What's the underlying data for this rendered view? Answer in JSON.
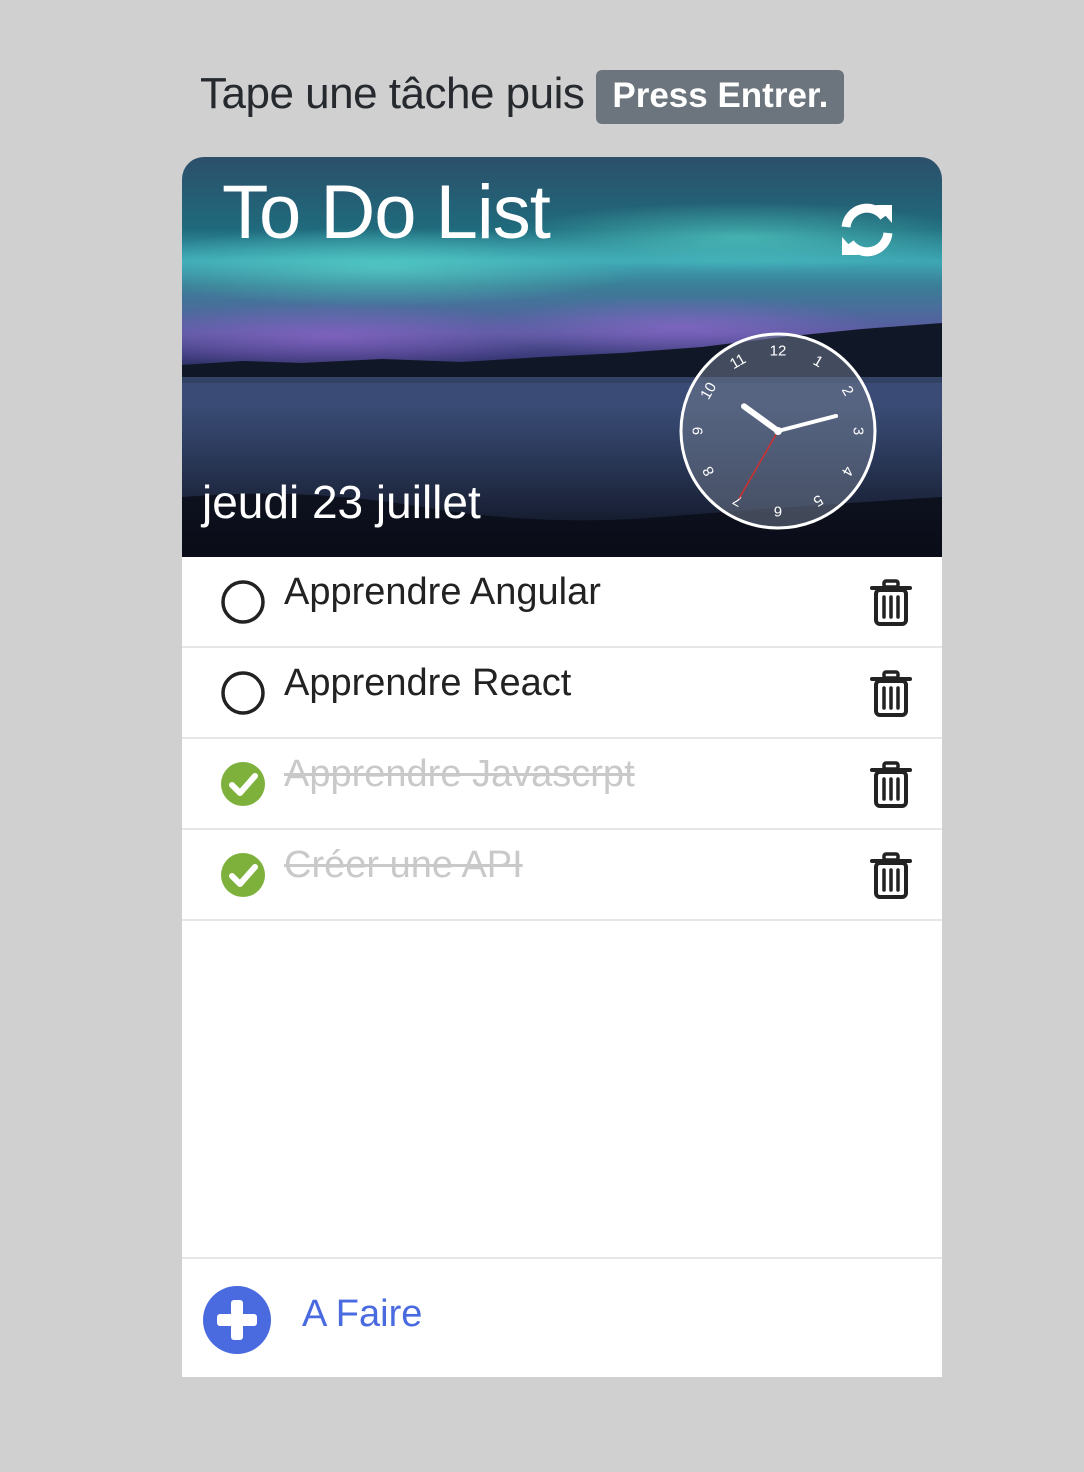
{
  "instruction": {
    "text": "Tape une tâche puis",
    "badge": "Press Entrer."
  },
  "header": {
    "title": "To Do List",
    "date": "jeudi 23 juillet",
    "refresh_icon": "refresh-icon"
  },
  "clock": {
    "numerals": [
      "12",
      "1",
      "2",
      "3",
      "4",
      "5",
      "6",
      "7",
      "8",
      "9",
      "10",
      "11"
    ],
    "hour": 10,
    "minute": 12,
    "second": 35
  },
  "todos": [
    {
      "label": "Apprendre Angular",
      "done": false
    },
    {
      "label": "Apprendre React",
      "done": false
    },
    {
      "label": "Apprendre Javascrpt",
      "done": true
    },
    {
      "label": "Créer une API",
      "done": true
    }
  ],
  "footer": {
    "add_label": "A Faire",
    "add_icon": "plus-circle-icon"
  },
  "colors": {
    "done_check": "#7db13c",
    "add_accent": "#4a6ae0",
    "badge_bg": "#6c757d",
    "page_bg": "#d0d0d0"
  }
}
